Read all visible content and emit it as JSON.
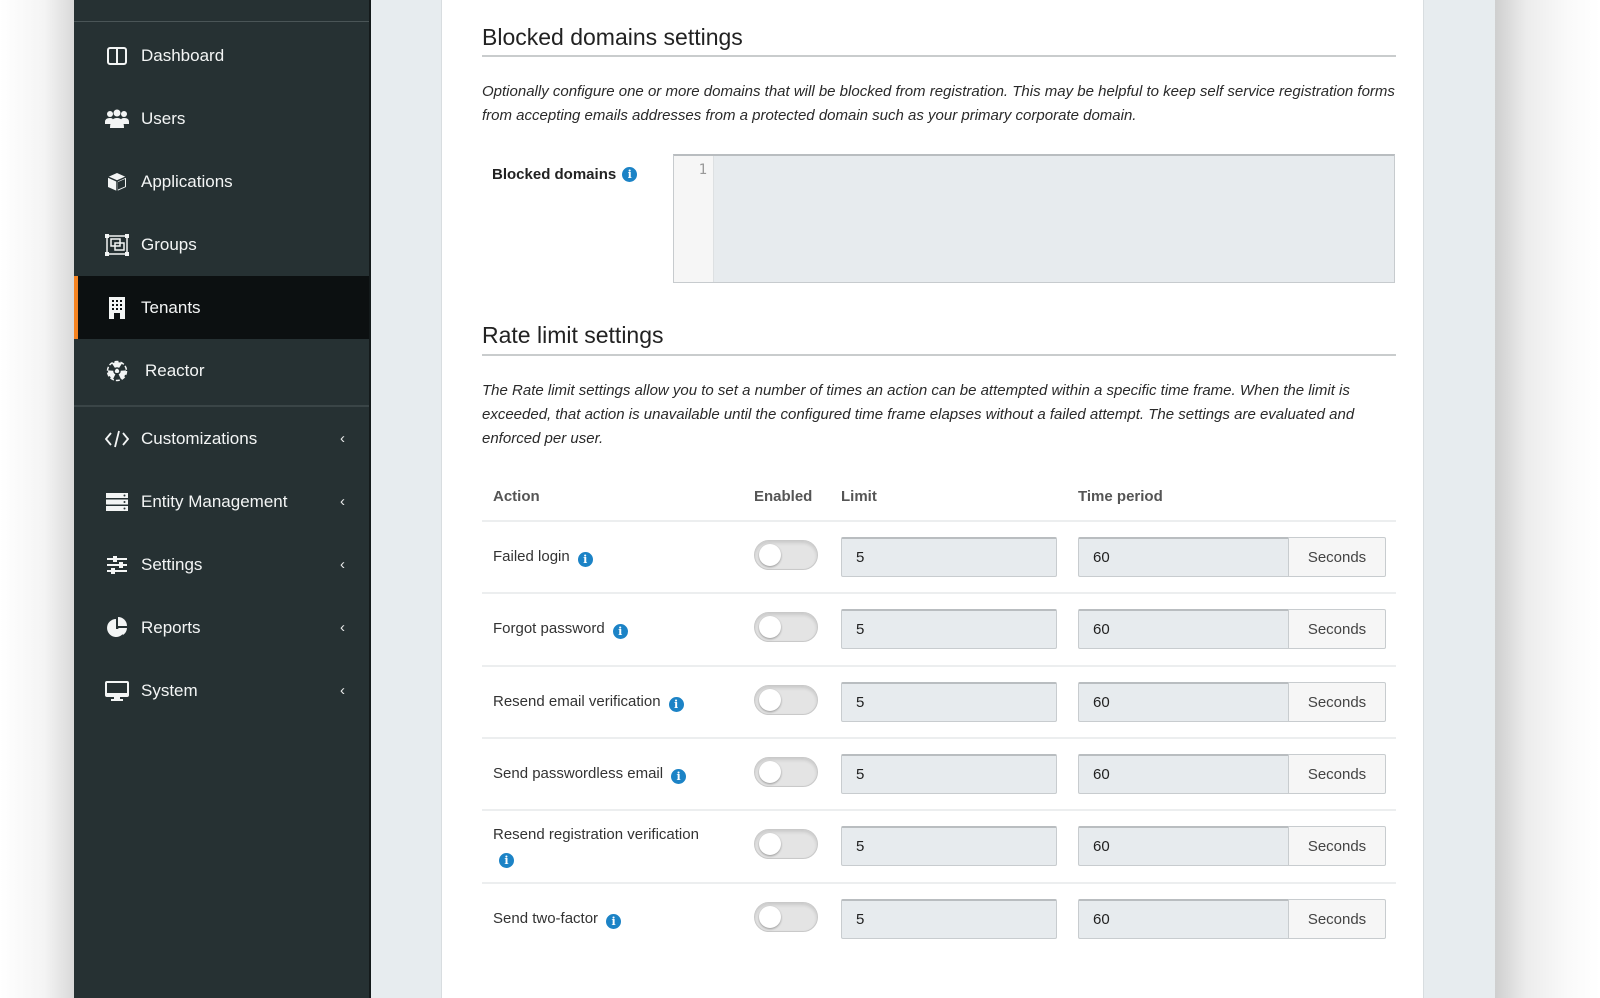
{
  "sidebar": {
    "items": [
      {
        "label": "Dashboard",
        "icon": "dashboard-icon",
        "active": false,
        "expandable": false
      },
      {
        "label": "Users",
        "icon": "users-icon",
        "active": false,
        "expandable": false
      },
      {
        "label": "Applications",
        "icon": "cube-icon",
        "active": false,
        "expandable": false
      },
      {
        "label": "Groups",
        "icon": "object-group-icon",
        "active": false,
        "expandable": false
      },
      {
        "label": "Tenants",
        "icon": "building-icon",
        "active": true,
        "expandable": false
      },
      {
        "label": "Reactor",
        "icon": "radiation-icon",
        "active": false,
        "expandable": false
      },
      {
        "label": "Customizations",
        "icon": "code-icon",
        "active": false,
        "expandable": true
      },
      {
        "label": "Entity Management",
        "icon": "server-icon",
        "active": false,
        "expandable": true
      },
      {
        "label": "Settings",
        "icon": "sliders-icon",
        "active": false,
        "expandable": true
      },
      {
        "label": "Reports",
        "icon": "pie-chart-icon",
        "active": false,
        "expandable": true
      },
      {
        "label": "System",
        "icon": "desktop-icon",
        "active": false,
        "expandable": true
      }
    ],
    "chevron": "‹",
    "accent_color": "#f58320"
  },
  "blocked_domains": {
    "title": "Blocked domains settings",
    "description": "Optionally configure one or more domains that will be blocked from registration. This may be helpful to keep self service registration forms from accepting emails addresses from a protected domain such as your primary corporate domain.",
    "field_label": "Blocked domains",
    "editor_line_number": "1",
    "editor_value": ""
  },
  "rate_limit": {
    "title": "Rate limit settings",
    "description": "The Rate limit settings allow you to set a number of times an action can be attempted within a specific time frame. When the limit is exceeded, that action is unavailable until the configured time frame elapses without a failed attempt. The settings are evaluated and enforced per user.",
    "headers": {
      "action": "Action",
      "enabled": "Enabled",
      "limit": "Limit",
      "time_period": "Time period"
    },
    "rows": [
      {
        "action": "Failed login",
        "enabled": false,
        "limit": "5",
        "time_period": "60",
        "unit": "Seconds"
      },
      {
        "action": "Forgot password",
        "enabled": false,
        "limit": "5",
        "time_period": "60",
        "unit": "Seconds"
      },
      {
        "action": "Resend email verification",
        "enabled": false,
        "limit": "5",
        "time_period": "60",
        "unit": "Seconds"
      },
      {
        "action": "Send passwordless email",
        "enabled": false,
        "limit": "5",
        "time_period": "60",
        "unit": "Seconds"
      },
      {
        "action": "Resend registration verification",
        "enabled": false,
        "limit": "5",
        "time_period": "60",
        "unit": "Seconds"
      },
      {
        "action": "Send two-factor",
        "enabled": false,
        "limit": "5",
        "time_period": "60",
        "unit": "Seconds"
      }
    ]
  },
  "info_glyph": "i"
}
